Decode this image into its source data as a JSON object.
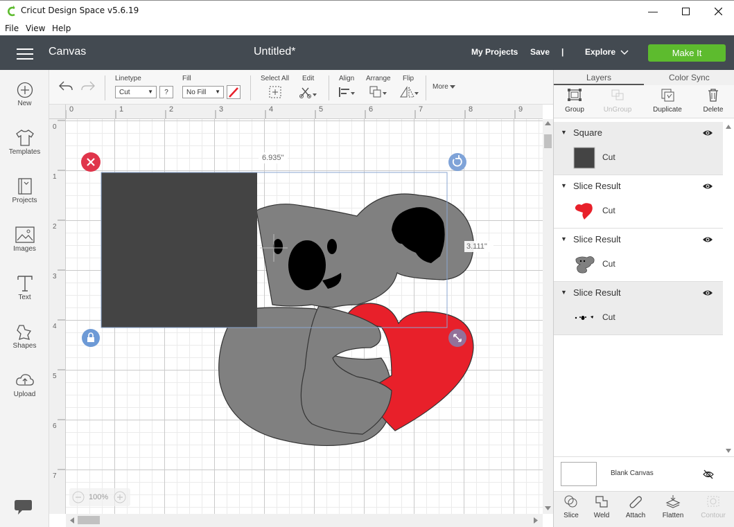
{
  "window": {
    "title": "Cricut Design Space  v5.6.19",
    "menu": [
      "File",
      "View",
      "Help"
    ]
  },
  "header": {
    "section": "Canvas",
    "doc_title": "Untitled*",
    "my_projects": "My Projects",
    "save": "Save",
    "separator": "|",
    "explore": "Explore",
    "make_it": "Make It",
    "make_it_color": "#5dbb2e"
  },
  "leftbar": {
    "items": [
      {
        "label": "New",
        "icon": "plus-circle-icon"
      },
      {
        "label": "Templates",
        "icon": "tshirt-icon"
      },
      {
        "label": "Projects",
        "icon": "book-icon"
      },
      {
        "label": "Images",
        "icon": "image-icon"
      },
      {
        "label": "Text",
        "icon": "text-T-icon"
      },
      {
        "label": "Shapes",
        "icon": "shapes-icon"
      },
      {
        "label": "Upload",
        "icon": "cloud-upload-icon"
      }
    ]
  },
  "toolbar": {
    "linetype_label": "Linetype",
    "linetype_value": "Cut",
    "help": "?",
    "fill_label": "Fill",
    "fill_value": "No Fill",
    "select_all": "Select All",
    "edit": "Edit",
    "align": "Align",
    "arrange": "Arrange",
    "flip": "Flip",
    "more": "More"
  },
  "rulers": {
    "h": [
      "0",
      "1",
      "2",
      "3",
      "4",
      "5",
      "6",
      "7",
      "8",
      "9"
    ],
    "v": [
      "0",
      "1",
      "2",
      "3",
      "4",
      "5",
      "6",
      "7"
    ]
  },
  "canvas": {
    "width_label": "6.935\"",
    "height_label": "3.111\"",
    "zoom": "100%"
  },
  "panel": {
    "tabs": [
      "Layers",
      "Color Sync"
    ],
    "actions": [
      {
        "label": "Group",
        "enabled": true
      },
      {
        "label": "UnGroup",
        "enabled": false
      },
      {
        "label": "Duplicate",
        "enabled": true
      },
      {
        "label": "Delete",
        "enabled": true
      }
    ],
    "layers": [
      {
        "name": "Square",
        "op": "Cut",
        "selected": true
      },
      {
        "name": "Slice Result",
        "op": "Cut",
        "selected": false
      },
      {
        "name": "Slice Result",
        "op": "Cut",
        "selected": false
      },
      {
        "name": "Slice Result",
        "op": "Cut",
        "selected": true
      }
    ],
    "blank_canvas": "Blank Canvas",
    "bottom_actions": [
      {
        "label": "Slice",
        "enabled": true
      },
      {
        "label": "Weld",
        "enabled": true
      },
      {
        "label": "Attach",
        "enabled": true
      },
      {
        "label": "Flatten",
        "enabled": true
      },
      {
        "label": "Contour",
        "enabled": false
      }
    ]
  },
  "colors": {
    "header": "#434a51",
    "heart": "#e8202a",
    "koala": "#808080",
    "square": "#444444"
  }
}
